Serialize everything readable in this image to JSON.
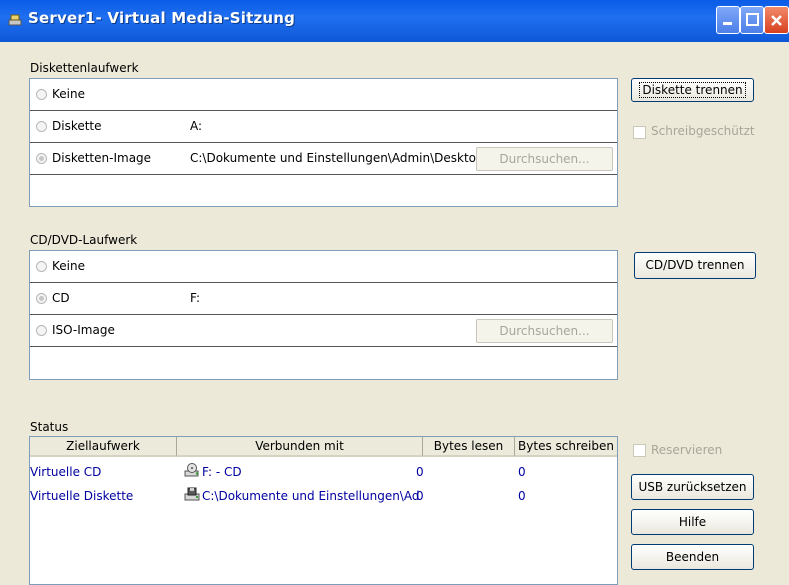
{
  "window": {
    "title": "Server1- Virtual Media-Sitzung"
  },
  "floppy": {
    "group_label": "Diskettenlaufwerk",
    "options": [
      {
        "label": "Keine",
        "value": "",
        "selected": false
      },
      {
        "label": "Diskette",
        "value": "A:",
        "selected": false
      },
      {
        "label": "Disketten-Image",
        "value": "C:\\Dokumente und Einstellungen\\Admin\\Desktop\\ds...",
        "selected": true
      }
    ],
    "browse_label": "Durchsuchen...",
    "disconnect_label": "Diskette trennen",
    "write_protect_label": "Schreibgeschützt"
  },
  "cddvd": {
    "group_label": "CD/DVD-Laufwerk",
    "options": [
      {
        "label": "Keine",
        "value": "",
        "selected": false
      },
      {
        "label": "CD",
        "value": "F:",
        "selected": true
      },
      {
        "label": "ISO-Image",
        "value": "",
        "selected": false
      }
    ],
    "browse_label": "Durchsuchen...",
    "disconnect_label": "CD/DVD trennen"
  },
  "status": {
    "group_label": "Status",
    "columns": [
      "Ziellaufwerk",
      "Verbunden mit",
      "Bytes lesen",
      "Bytes schreiben"
    ],
    "rows": [
      {
        "target": "Virtuelle CD",
        "icon": "cd-drive-icon",
        "connected": "F: - CD",
        "read": "0",
        "write": "0"
      },
      {
        "target": "Virtuelle Diskette",
        "icon": "floppy-drive-icon",
        "connected": "C:\\Dokumente und Einstellungen\\Ad...",
        "read": "0",
        "write": "0"
      }
    ]
  },
  "side": {
    "reserve_label": "Reservieren",
    "usb_reset_label": "USB zurücksetzen",
    "help_label": "Hilfe",
    "exit_label": "Beenden"
  }
}
